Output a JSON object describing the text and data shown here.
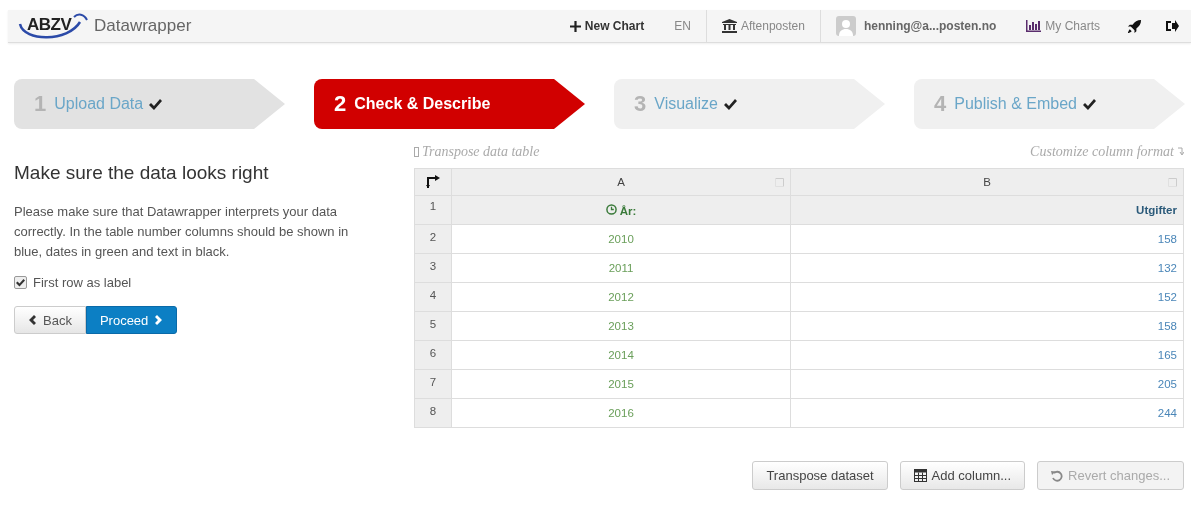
{
  "nav": {
    "logo": "ABZV",
    "app_name": "Datawrapper",
    "items": [
      {
        "kind": "new",
        "label": "New Chart"
      },
      {
        "kind": "lang",
        "label": "EN"
      },
      {
        "kind": "org",
        "label": "Aftenposten"
      },
      {
        "kind": "user",
        "label": "henning@a...posten.no"
      },
      {
        "kind": "charts",
        "label": "My Charts"
      },
      {
        "kind": "rocket"
      },
      {
        "kind": "logout"
      }
    ]
  },
  "steps": [
    {
      "number": "1",
      "label": "Upload Data",
      "selected": false,
      "done": true
    },
    {
      "number": "2",
      "label": "Check & Describe",
      "selected": true,
      "done": false
    },
    {
      "number": "3",
      "label": "Visualize",
      "selected": false,
      "done": true
    },
    {
      "number": "4",
      "label": "Publish & Embed",
      "selected": false,
      "done": true
    }
  ],
  "intro": {
    "heading": "Make sure the data looks right",
    "description": "Please make sure that Datawrapper interprets your data correctly. In the table number columns should be shown in blue, dates in green and text in black.",
    "checkbox": {
      "label": "First row as label",
      "checked": true
    },
    "buttons": [
      {
        "kind": "back",
        "label": "Back"
      },
      {
        "kind": "proceed",
        "label": "Proceed"
      }
    ]
  },
  "table": {
    "hint_left": "Transpose data table",
    "hint_right": "Customize column format",
    "columns": [
      {
        "letter": "A",
        "kind": "date"
      },
      {
        "letter": "B",
        "kind": "number"
      }
    ],
    "header_row": {
      "number": "1",
      "cells": [
        "År:",
        "Utgifter"
      ]
    },
    "rows": [
      {
        "number": "2",
        "cells": [
          "2010",
          "158"
        ]
      },
      {
        "number": "3",
        "cells": [
          "2011",
          "132"
        ]
      },
      {
        "number": "4",
        "cells": [
          "2012",
          "152"
        ]
      },
      {
        "number": "5",
        "cells": [
          "2013",
          "158"
        ]
      },
      {
        "number": "6",
        "cells": [
          "2014",
          "165"
        ]
      },
      {
        "number": "7",
        "cells": [
          "2015",
          "205"
        ]
      },
      {
        "number": "8",
        "cells": [
          "2016",
          "244"
        ]
      }
    ]
  },
  "actions": [
    {
      "kind": "transpose",
      "label": "Transpose dataset",
      "disabled": false
    },
    {
      "kind": "add",
      "label": "Add column...",
      "disabled": false
    },
    {
      "kind": "revert",
      "label": "Revert changes...",
      "disabled": true
    }
  ]
}
